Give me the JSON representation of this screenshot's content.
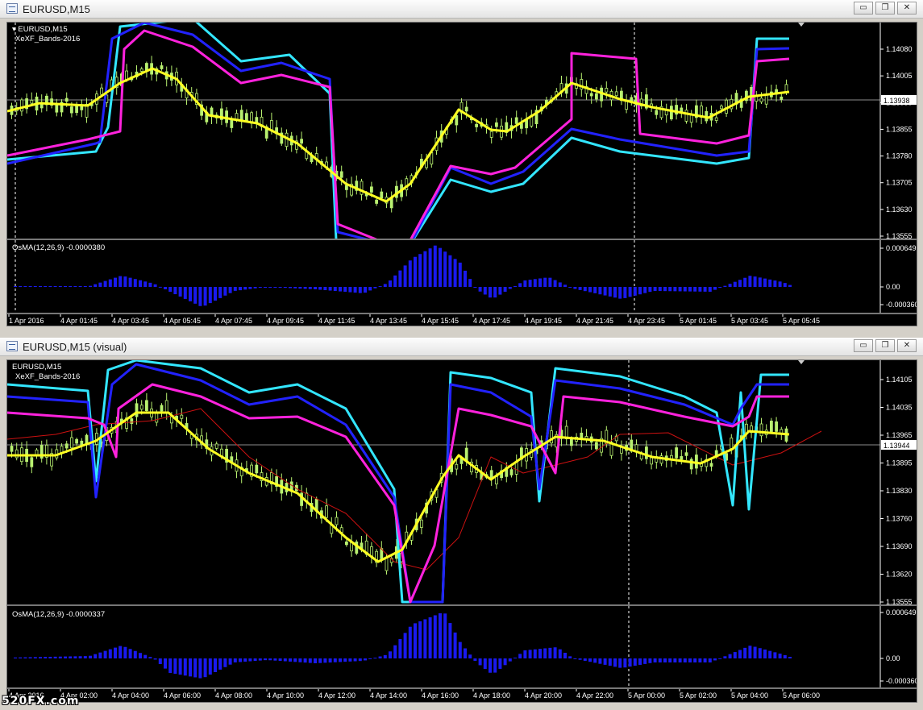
{
  "windows": [
    {
      "title": "EURUSD,M15",
      "symbol_label": "EURUSD,M15",
      "indicator_label": "XeXF_Bands-2016",
      "price_ticks": [
        "1.14080",
        "1.14005",
        "1.13930",
        "1.13855",
        "1.13780",
        "1.13705",
        "1.13630",
        "1.13555"
      ],
      "current_price": "1.13938",
      "osma_label": "OsMA(12,26,9) -0.0000380",
      "osma_ticks": [
        "0.000649",
        "0.00",
        "-0.000360"
      ],
      "time_labels": [
        "1 Apr 2016",
        "4 Apr 01:45",
        "4 Apr 03:45",
        "4 Apr 05:45",
        "4 Apr 07:45",
        "4 Apr 09:45",
        "4 Apr 11:45",
        "4 Apr 13:45",
        "4 Apr 15:45",
        "4 Apr 17:45",
        "4 Apr 19:45",
        "4 Apr 21:45",
        "4 Apr 23:45",
        "5 Apr 01:45",
        "5 Apr 03:45",
        "5 Apr 05:45"
      ]
    },
    {
      "title": "EURUSD,M15 (visual)",
      "symbol_label": "EURUSD,M15",
      "indicator_label": "XeXF_Bands-2016",
      "price_ticks": [
        "1.14105",
        "1.14035",
        "1.13965",
        "1.13895",
        "1.13830",
        "1.13760",
        "1.13690",
        "1.13620",
        "1.13555"
      ],
      "current_price": "1.13944",
      "osma_label": "OsMA(12,26,9) -0.0000337",
      "osma_ticks": [
        "0.000649",
        "0.00",
        "-0.000360"
      ],
      "time_labels": [
        "4 Apr 2016",
        "4 Apr 02:00",
        "4 Apr 04:00",
        "4 Apr 06:00",
        "4 Apr 08:00",
        "4 Apr 10:00",
        "4 Apr 12:00",
        "4 Apr 14:00",
        "4 Apr 16:00",
        "4 Apr 18:00",
        "4 Apr 20:00",
        "4 Apr 22:00",
        "5 Apr 00:00",
        "5 Apr 02:00",
        "5 Apr 04:00",
        "5 Apr 06:00"
      ]
    }
  ],
  "window_buttons": {
    "minimize": "▭",
    "restore": "❐",
    "close": "✕"
  },
  "watermark": "520FX.com",
  "colors": {
    "background": "#000000",
    "candle": "#b8f070",
    "yellow": "#ffff22",
    "magenta": "#ff22dd",
    "blue": "#2222ff",
    "cyan": "#33e6ff",
    "osma": "#1a1aee",
    "grid_line": "#ffffff",
    "red": "#cc1111"
  }
}
